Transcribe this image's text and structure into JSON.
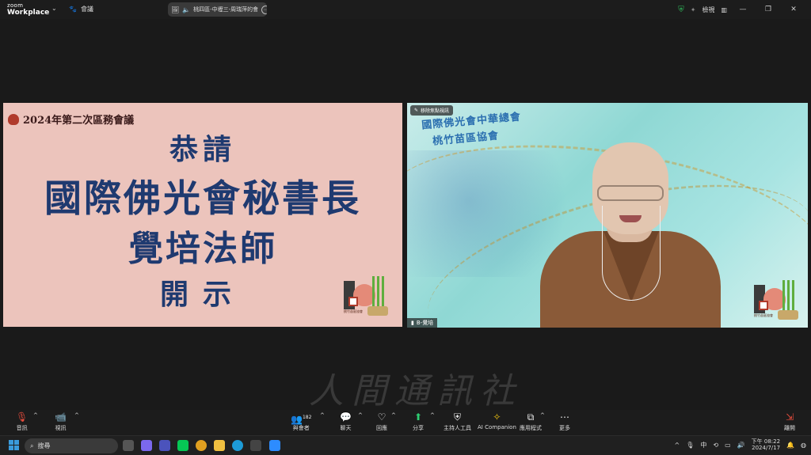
{
  "app": {
    "logo_line1": "zoom",
    "logo_line2": "Workplace",
    "meetings_label": "會議"
  },
  "meeting_pill": {
    "title": "桃四區-中壢三-周瑞萍的會"
  },
  "top_right": {
    "view_label": "檢視"
  },
  "slide": {
    "header": "2024年第二次區務會議",
    "line1": "恭請",
    "line2": "國際佛光會秘書長",
    "line3": "覺培法師",
    "line4": "開示",
    "emblem_text": "桃竹苗區協會"
  },
  "video": {
    "badge": "移除焦點視訊",
    "org_line1": "國際佛光會中華總會",
    "org_line2": "桃竹苗區協會",
    "participant": "B-覺培",
    "emblem_text": "桃竹苗區協會"
  },
  "toolbar": {
    "audio": "音訊",
    "video": "視訊",
    "participants": "與會者",
    "participants_count": "182",
    "chat": "聊天",
    "react": "回應",
    "share": "分享",
    "host_tools": "主持人工具",
    "ai": "AI Companion",
    "apps": "應用程式",
    "more": "更多",
    "leave": "離開"
  },
  "watermark": "人間通訊社",
  "taskbar": {
    "search_placeholder": "搜尋",
    "time": "下午 08:22",
    "date": "2024/7/17",
    "ime": "中"
  },
  "colors": {
    "accent_green": "#2ecc71",
    "slide_bg": "#ecc4bc",
    "slide_text": "#1f3a70"
  }
}
